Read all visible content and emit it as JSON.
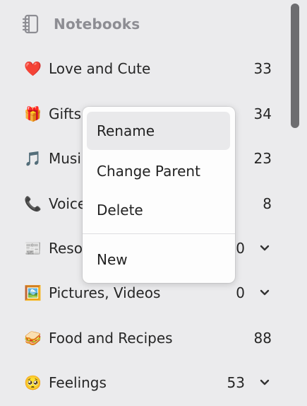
{
  "sidebar": {
    "header": {
      "title": "Notebooks",
      "icon": "notebook-icon"
    },
    "items": [
      {
        "emoji": "❤️",
        "icon": "heart-icon",
        "label": "Love and Cute",
        "count": "33",
        "has_chevron": false
      },
      {
        "emoji": "🎁",
        "icon": "gift-icon",
        "label": "Gifts",
        "count": "34",
        "has_chevron": false
      },
      {
        "emoji": "🎵",
        "icon": "music-note-icon",
        "label": "Musi",
        "count": "23",
        "has_chevron": false
      },
      {
        "emoji": "📞",
        "icon": "phone-icon",
        "label": "Voice",
        "count": "8",
        "has_chevron": false
      },
      {
        "emoji": "📰",
        "icon": "newspaper-icon",
        "label": "Reso",
        "count": "0",
        "has_chevron": true
      },
      {
        "emoji": "🖼️",
        "icon": "picture-icon",
        "label": "Pictures, Videos",
        "count": "0",
        "has_chevron": true
      },
      {
        "emoji": "🥪",
        "icon": "sandwich-icon",
        "label": "Food and Recipes",
        "count": "88",
        "has_chevron": false
      },
      {
        "emoji": "🥺",
        "icon": "pleading-face-icon",
        "label": "Feelings",
        "count": "53",
        "has_chevron": true
      }
    ]
  },
  "context_menu": {
    "items": [
      {
        "label": "Rename",
        "highlighted": true
      },
      {
        "label": "Change Parent",
        "highlighted": false
      },
      {
        "label": "Delete",
        "highlighted": false
      },
      {
        "label": "New",
        "highlighted": false
      }
    ]
  },
  "colors": {
    "background": "#ebebed",
    "menu_background": "#fdfdfd",
    "menu_hover": "#e9e9eb",
    "scrollbar": "#6d6d70",
    "header_text": "#8d8d93"
  }
}
